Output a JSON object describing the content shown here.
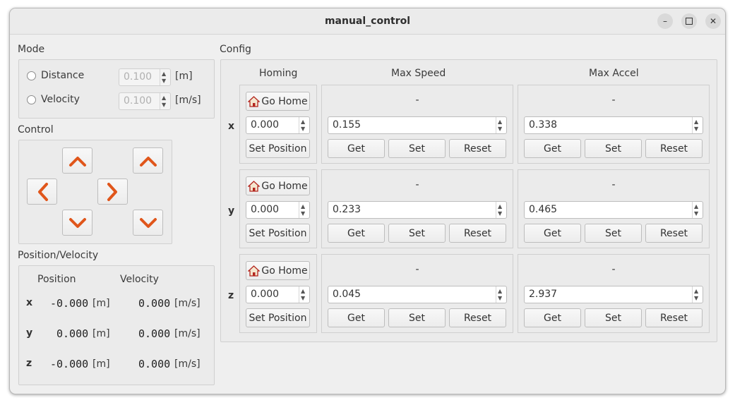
{
  "window": {
    "title": "manual_control",
    "minimize_icon": "minimize-icon",
    "maximize_icon": "maximize-icon",
    "close_icon": "close-icon"
  },
  "mode": {
    "title": "Mode",
    "distance": {
      "label": "Distance",
      "value": "0.100",
      "unit": "[m]"
    },
    "velocity": {
      "label": "Velocity",
      "value": "0.100",
      "unit": "[m/s]"
    }
  },
  "control": {
    "title": "Control",
    "accent": "#e0561b"
  },
  "posvel": {
    "title": "Position/Velocity",
    "position_header": "Position",
    "velocity_header": "Velocity",
    "rows": [
      {
        "axis": "x",
        "position": "-0.000",
        "pos_unit": "[m]",
        "velocity": "0.000",
        "vel_unit": "[m/s]"
      },
      {
        "axis": "y",
        "position": "0.000",
        "pos_unit": "[m]",
        "velocity": "0.000",
        "vel_unit": "[m/s]"
      },
      {
        "axis": "z",
        "position": "-0.000",
        "pos_unit": "[m]",
        "velocity": "0.000",
        "vel_unit": "[m/s]"
      }
    ]
  },
  "config": {
    "title": "Config",
    "headers": {
      "homing": "Homing",
      "max_speed": "Max Speed",
      "max_accel": "Max Accel"
    },
    "buttons": {
      "go_home": "Go Home",
      "set_position": "Set Position",
      "get": "Get",
      "set": "Set",
      "reset": "Reset"
    },
    "axes": [
      {
        "axis": "x",
        "home_value": "0.000",
        "speed_status": "-",
        "speed_value": "0.155",
        "accel_status": "-",
        "accel_value": "0.338"
      },
      {
        "axis": "y",
        "home_value": "0.000",
        "speed_status": "-",
        "speed_value": "0.233",
        "accel_status": "-",
        "accel_value": "0.465"
      },
      {
        "axis": "z",
        "home_value": "0.000",
        "speed_status": "-",
        "speed_value": "0.045",
        "accel_status": "-",
        "accel_value": "2.937"
      }
    ]
  }
}
